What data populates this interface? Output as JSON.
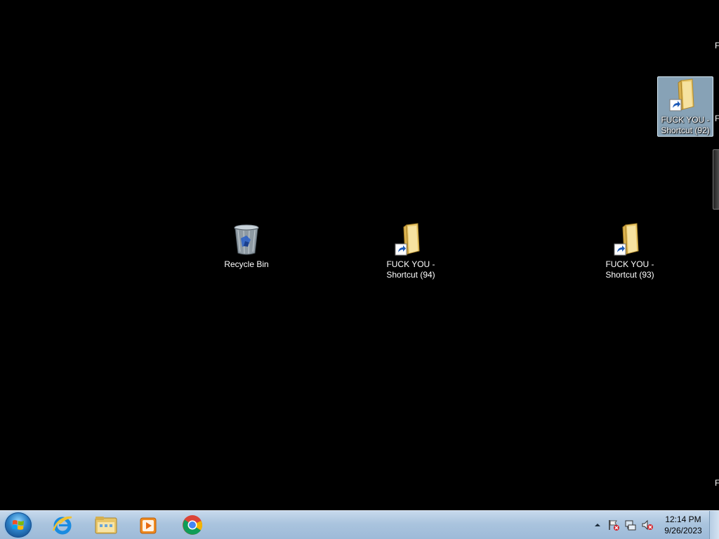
{
  "desktop": {
    "icons": [
      {
        "label": "Recycle Bin",
        "icon": "recycle-bin-icon",
        "selected": false
      },
      {
        "label": "FUCK YOU - Shortcut (94)",
        "icon": "folder-shortcut-icon",
        "selected": false
      },
      {
        "label": "FUCK YOU - Shortcut (93)",
        "icon": "folder-shortcut-icon",
        "selected": false
      },
      {
        "label": "FUCK YOU - Shortcut (92)",
        "icon": "folder-shortcut-icon",
        "selected": true
      }
    ],
    "edge_fragments": [
      "F S",
      "F S",
      "F S"
    ]
  },
  "taskbar": {
    "start_button": "windows-start-orb-icon",
    "pinned": [
      {
        "name": "Internet Explorer",
        "icon": "internet-explorer-icon"
      },
      {
        "name": "Windows Explorer",
        "icon": "file-explorer-icon"
      },
      {
        "name": "Windows Media Player",
        "icon": "media-player-icon"
      },
      {
        "name": "Google Chrome",
        "icon": "chrome-icon"
      }
    ],
    "tray": {
      "icons": [
        "show-hidden-icons-icon",
        "action-center-flag-icon",
        "network-icon",
        "volume-muted-icon"
      ],
      "time": "12:14 PM",
      "date": "9/26/2023"
    }
  },
  "colors": {
    "desktop_background": "#000000",
    "selection": "#adcfe9",
    "taskbar": "#aac4de"
  }
}
